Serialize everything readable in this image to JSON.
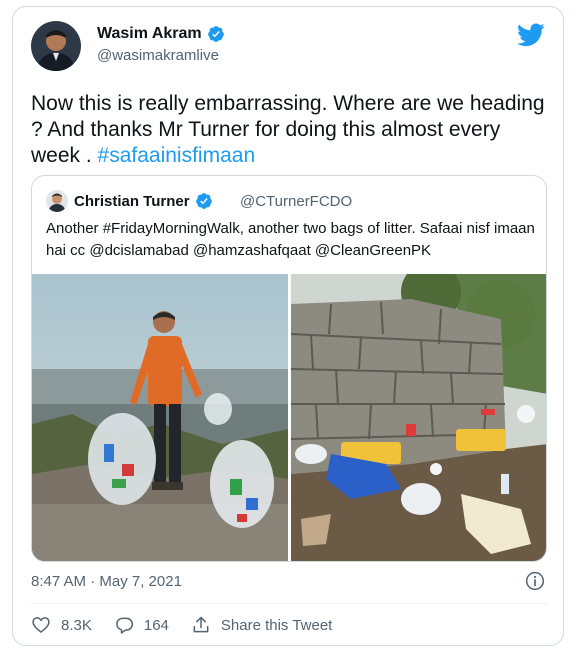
{
  "author": {
    "name": "Wasim Akram",
    "handle": "@wasimakramlive"
  },
  "tweet": {
    "text_main": "Now this is really embarrassing. Where are we heading ? And thanks Mr Turner for doing this almost every week . ",
    "hashtag": "#safaainisfimaan"
  },
  "quote": {
    "name": "Christian Turner",
    "handle": "@CTurnerFCDO",
    "text": "Another #FridayMorningWalk, another two bags of litter. Safaai nisf imaan hai cc @dcislamabad @hamzashafqaat @CleanGreenPK"
  },
  "meta": {
    "timestamp": "8:47 AM · May 7, 2021"
  },
  "actions": {
    "likes": "8.3K",
    "replies": "164",
    "share_label": "Share this Tweet"
  },
  "colors": {
    "accent": "#1d9bf0",
    "muted": "#536471",
    "border": "#cfd9de"
  },
  "icons": [
    "verified-badge-icon",
    "twitter-bird-icon",
    "info-icon",
    "heart-icon",
    "reply-icon",
    "share-icon"
  ]
}
